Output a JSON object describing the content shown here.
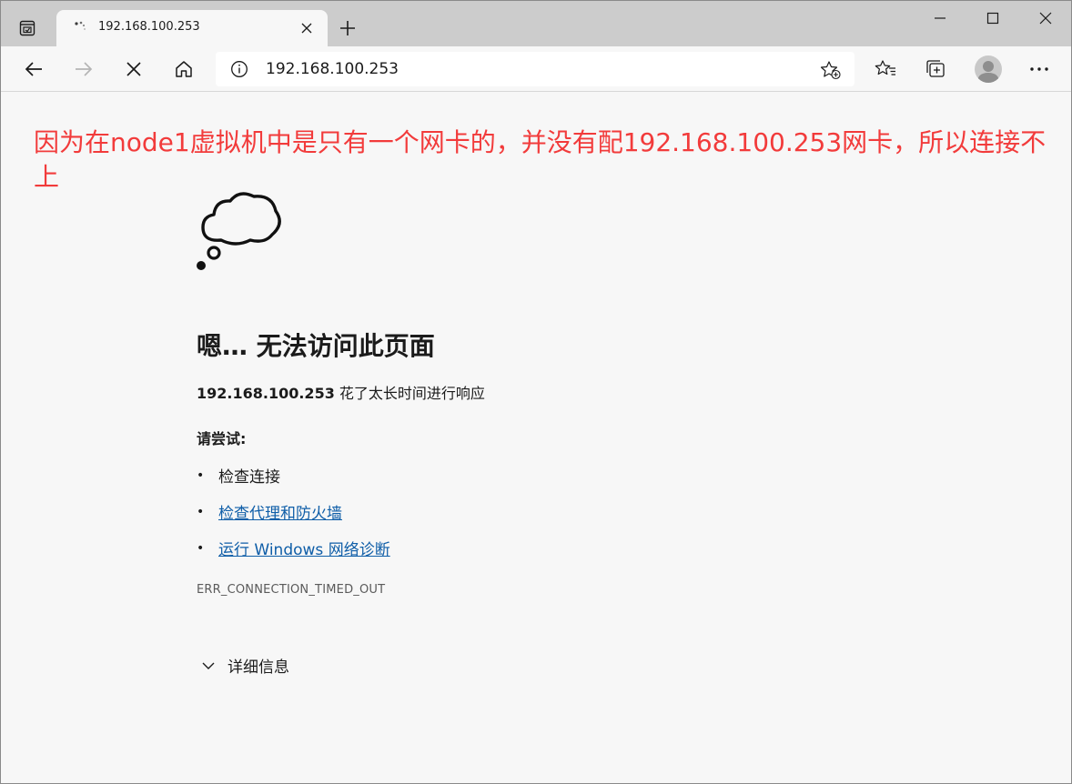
{
  "tab": {
    "title": "192.168.100.253"
  },
  "address_bar": {
    "url": "192.168.100.253"
  },
  "annotation": {
    "text": "因为在node1虚拟机中是只有一个网卡的，并没有配192.168.100.253网卡，所以连接不上",
    "color": "#f23b3b"
  },
  "error_page": {
    "title": "嗯… 无法访问此页面",
    "host": "192.168.100.253",
    "description_suffix": " 花了太长时间进行响应",
    "try_label": "请尝试:",
    "suggestions": [
      {
        "label": "检查连接",
        "is_link": false
      },
      {
        "label": "检查代理和防火墙",
        "is_link": true
      },
      {
        "label": "运行 Windows 网络诊断",
        "is_link": true
      }
    ],
    "error_code": "ERR_CONNECTION_TIMED_OUT",
    "details_label": "详细信息"
  },
  "colors": {
    "link": "#0f5ea8",
    "tabstrip": "#cccccc",
    "page_bg": "#f7f7f7"
  },
  "icons": {
    "tab_actions": "tab-actions-icon",
    "favicon": "loading-spinner-icon",
    "back": "back-arrow-icon",
    "forward": "forward-arrow-icon",
    "stop": "stop-icon",
    "home": "home-icon",
    "info": "info-icon",
    "add_favorite": "add-favorite-icon",
    "favorites": "favorites-icon",
    "collections": "collections-icon",
    "profile": "profile-avatar",
    "more": "more-icon",
    "cloud": "thought-cloud-icon"
  }
}
